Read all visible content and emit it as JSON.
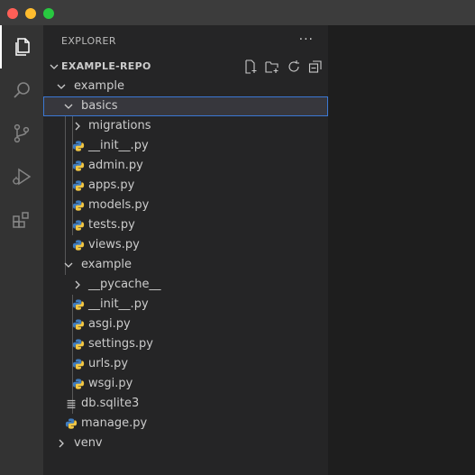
{
  "window": {
    "controls": [
      "close",
      "minimize",
      "maximize"
    ]
  },
  "activity_bar": {
    "items": [
      {
        "name": "explorer",
        "icon": "files-icon",
        "active": true
      },
      {
        "name": "search",
        "icon": "search-icon",
        "active": false
      },
      {
        "name": "source-control",
        "icon": "source-control-icon",
        "active": false
      },
      {
        "name": "run-debug",
        "icon": "run-debug-icon",
        "active": false
      },
      {
        "name": "extensions",
        "icon": "extensions-icon",
        "active": false
      }
    ]
  },
  "sidebar": {
    "title": "EXPLORER",
    "more_label": "···",
    "section": {
      "title": "EXAMPLE-REPO",
      "actions": [
        "new-file-icon",
        "new-folder-icon",
        "refresh-icon",
        "collapse-all-icon"
      ]
    }
  },
  "tree": [
    {
      "label": "example",
      "type": "folder",
      "expanded": true
    },
    {
      "label": "basics",
      "type": "folder",
      "expanded": true,
      "selected": true
    },
    {
      "label": "migrations",
      "type": "folder",
      "expanded": false
    },
    {
      "label": "__init__.py",
      "type": "python"
    },
    {
      "label": "admin.py",
      "type": "python"
    },
    {
      "label": "apps.py",
      "type": "python"
    },
    {
      "label": "models.py",
      "type": "python"
    },
    {
      "label": "tests.py",
      "type": "python"
    },
    {
      "label": "views.py",
      "type": "python"
    },
    {
      "label": "example",
      "type": "folder",
      "expanded": true
    },
    {
      "label": "__pycache__",
      "type": "folder",
      "expanded": false
    },
    {
      "label": "__init__.py",
      "type": "python"
    },
    {
      "label": "asgi.py",
      "type": "python"
    },
    {
      "label": "settings.py",
      "type": "python"
    },
    {
      "label": "urls.py",
      "type": "python"
    },
    {
      "label": "wsgi.py",
      "type": "python"
    },
    {
      "label": "db.sqlite3",
      "type": "database"
    },
    {
      "label": "manage.py",
      "type": "python"
    },
    {
      "label": "venv",
      "type": "folder",
      "expanded": false
    }
  ],
  "colors": {
    "selection_border": "#3b78d4",
    "python_blue": "#3f7cbf",
    "python_yellow": "#f2c744"
  }
}
